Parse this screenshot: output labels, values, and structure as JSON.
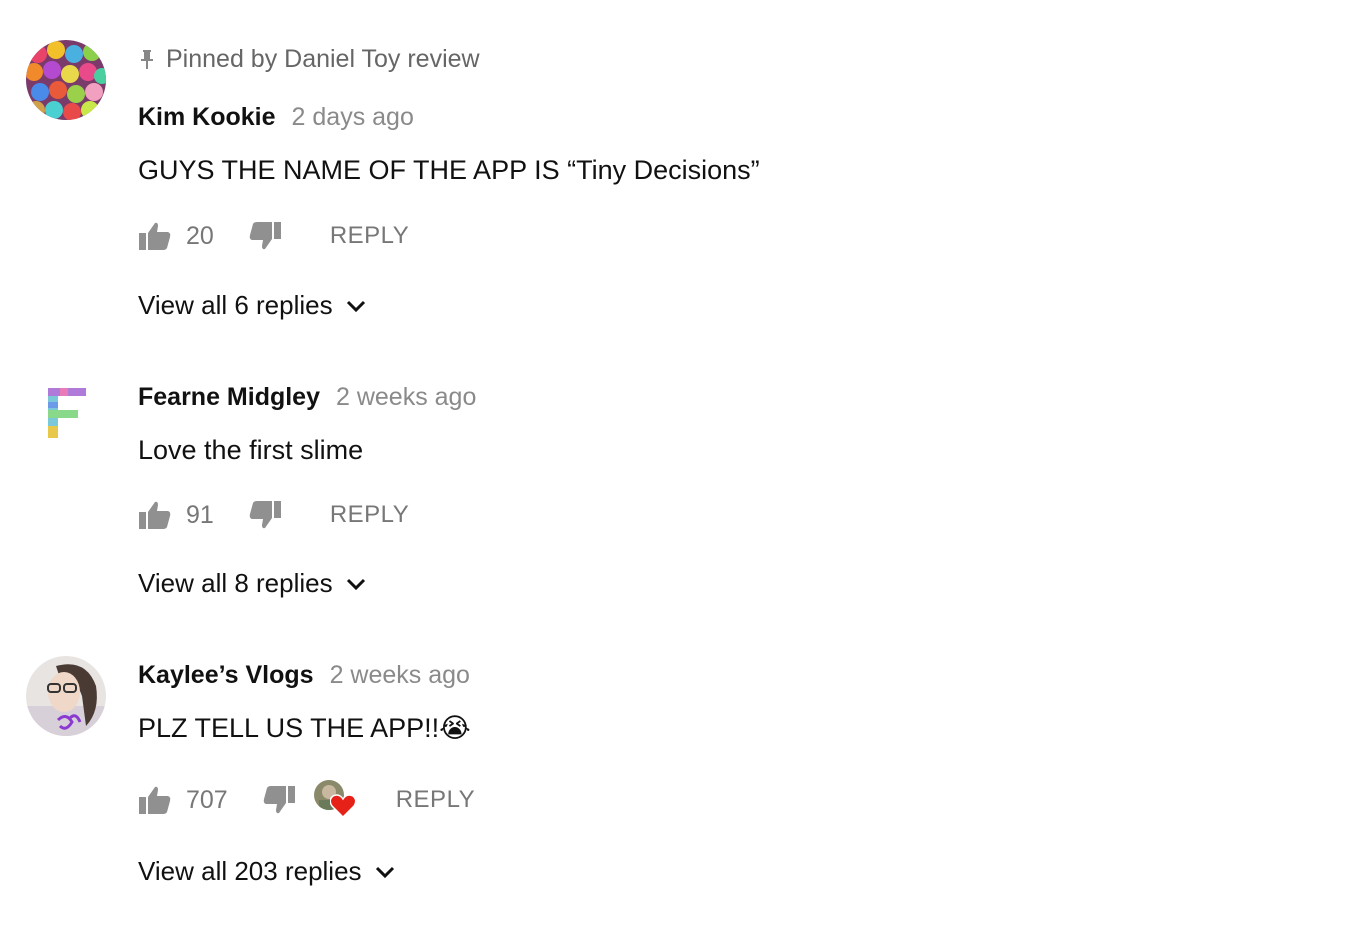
{
  "comments": [
    {
      "pinned_label": "Pinned by Daniel Toy review",
      "author": "Kim Kookie",
      "time": "2 days ago",
      "text": "GUYS THE NAME OF THE APP IS “Tiny Decisions”",
      "likes": "20",
      "reply_label": "REPLY",
      "view_replies": "View all 6 replies",
      "avatar": "colorful-candy-icon"
    },
    {
      "author": "Fearne Midgley",
      "time": "2 weeks ago",
      "text": "Love the first slime",
      "likes": "91",
      "reply_label": "REPLY",
      "view_replies": "View all 8 replies",
      "avatar": "letter-f-glitter-icon"
    },
    {
      "author": "Kaylee’s Vlogs",
      "time": "2 weeks ago",
      "text": "PLZ TELL US THE APP!!😭",
      "likes": "707",
      "reply_label": "REPLY",
      "view_replies": "View all 203 replies",
      "avatar": "selfie-photo-icon",
      "creator_heart": true
    }
  ],
  "colors": {
    "text": "#111111",
    "muted": "#777777",
    "time": "#8a8a8a",
    "heart": "#e62117"
  }
}
